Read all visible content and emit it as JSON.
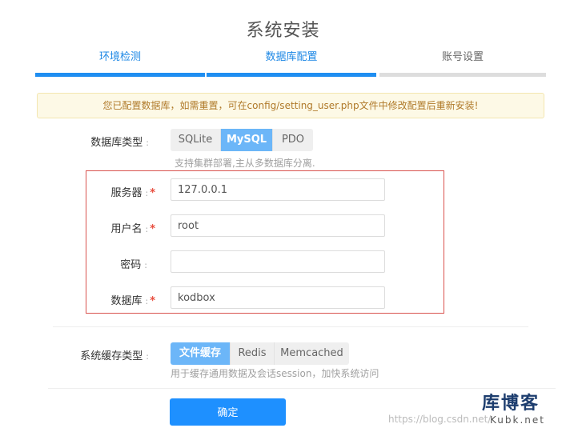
{
  "page": {
    "title": "系统安装"
  },
  "steps": [
    {
      "label": "环境检测"
    },
    {
      "label": "数据库配置"
    },
    {
      "label": "账号设置"
    }
  ],
  "notice": {
    "text": "您已配置数据库，如需重置，可在config/setting_user.php文件中修改配置后重新安装!"
  },
  "db_type": {
    "label": "数据库类型",
    "options": [
      "SQLite",
      "MySQL",
      "PDO"
    ],
    "selected": "MySQL",
    "hint": "支持集群部署,主从多数据库分离."
  },
  "fields": {
    "server": {
      "label": "服务器",
      "value": "127.0.0.1"
    },
    "username": {
      "label": "用户名",
      "value": "root"
    },
    "password": {
      "label": "密码",
      "value": ""
    },
    "database": {
      "label": "数据库",
      "value": "kodbox"
    }
  },
  "cache_type": {
    "label": "系统缓存类型",
    "options": [
      "文件缓存",
      "Redis",
      "Memcached"
    ],
    "selected": "文件缓存",
    "hint": "用于缓存通用数据及会话session，加快系统访问"
  },
  "confirm": {
    "label": "确定"
  },
  "watermark": {
    "url": "https://blog.csdn.net/",
    "logo_cn": "库博客",
    "logo_en": "Kubk.net"
  },
  "common": {
    "colon": ":",
    "required": "*"
  },
  "colors": {
    "accent": "#1e90ff",
    "selected_seg": "#6cb6f8",
    "required": "#e84c3d",
    "notice_bg": "#fdf9e6"
  }
}
